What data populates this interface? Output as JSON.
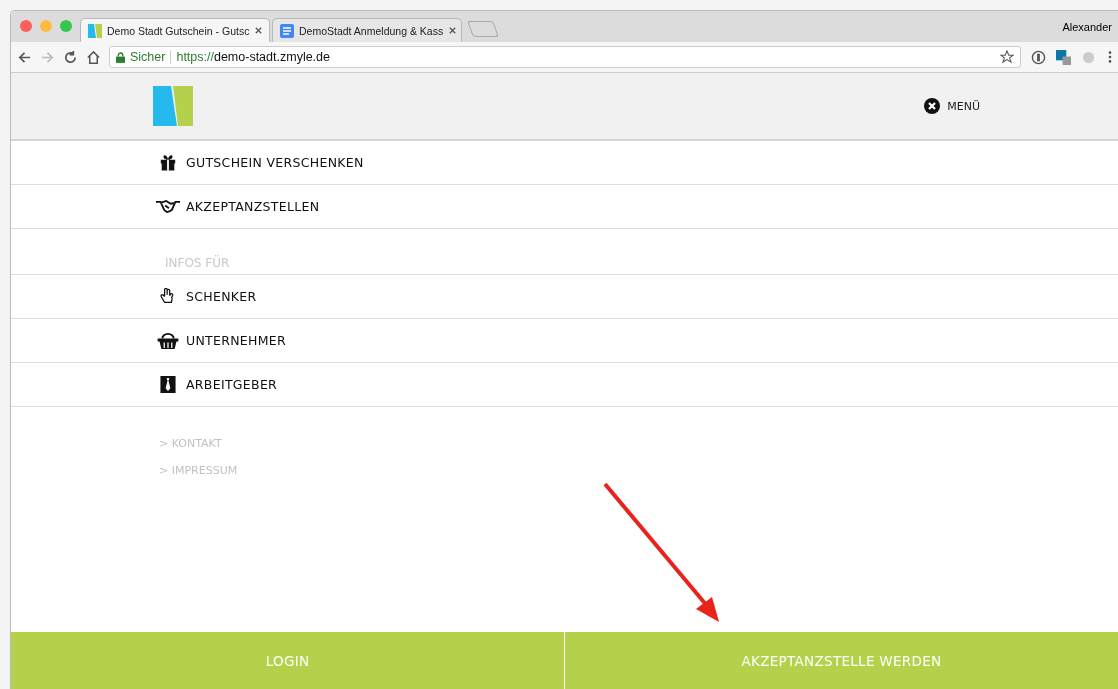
{
  "browser": {
    "tabs": [
      {
        "title": "Demo Stadt Gutschein - Gutsc",
        "kind": "site",
        "selected": true
      },
      {
        "title": "DemoStadt Anmeldung & Kass",
        "kind": "doc",
        "selected": false
      }
    ],
    "profile": "Alexander",
    "secure_label": "Sicher",
    "url_scheme": "https://",
    "url_host": "demo-stadt.zmyle.de"
  },
  "header": {
    "menu_label": "MENÜ"
  },
  "menu": [
    {
      "label": "GUTSCHEIN VERSCHENKEN"
    },
    {
      "label": "AKZEPTANZSTELLEN"
    }
  ],
  "infos": {
    "heading": "INFOS FÜR",
    "items": [
      {
        "label": "SCHENKER"
      },
      {
        "label": "UNTERNEHMER"
      },
      {
        "label": "ARBEITGEBER"
      }
    ]
  },
  "links": [
    "> KONTAKT",
    "> IMPRESSUM"
  ],
  "footer": {
    "buttons": [
      "LOGIN",
      "AKZEPTANZSTELLE WERDEN"
    ]
  }
}
